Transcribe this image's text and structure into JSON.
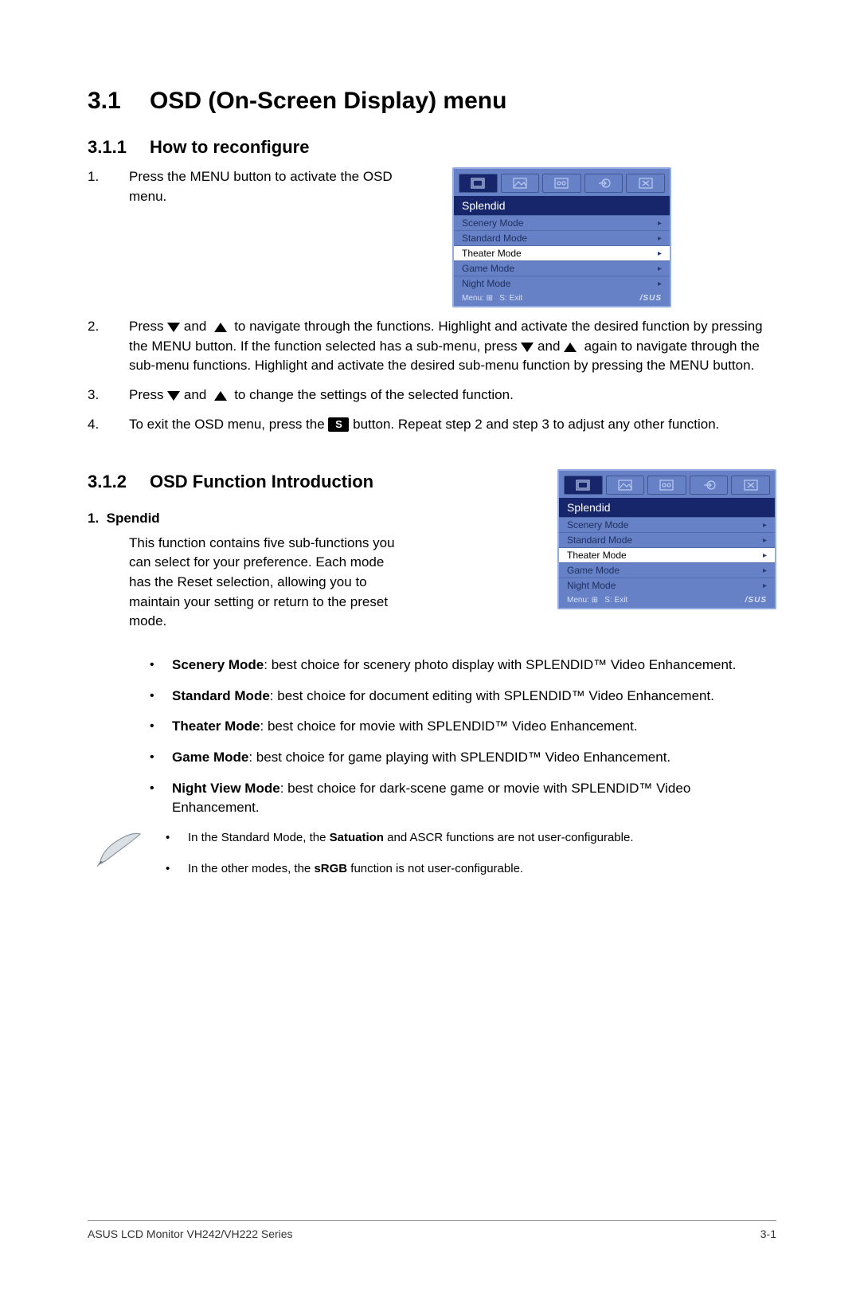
{
  "h1_num": "3.1",
  "h1_title": "OSD (On-Screen Display) menu",
  "h2a_num": "3.1.1",
  "h2a_title": "How to reconfigure",
  "step1": "Press the MENU button to activate the OSD menu.",
  "step2a": "Press ",
  "step2b": " and ",
  "step2c": " to navigate through the functions. Highlight and activate the desired function by pressing the MENU button. If the function selected has a sub-menu, press ",
  "step2d": " and ",
  "step2e": " again to navigate through the sub-menu functions. Highlight and activate the desired sub-menu function by pressing the MENU button.",
  "step3a": "Press ",
  "step3b": " and ",
  "step3c": " to change the settings of the selected function.",
  "step4a": "To exit the OSD menu, press the ",
  "step4b": " button. Repeat step 2 and step 3 to adjust any other function.",
  "s_label": "S",
  "h2b_num": "3.1.2",
  "h2b_title": "OSD Function Introduction",
  "sub1_num": "1.",
  "sub1_title": "Spendid",
  "sub1_body": "This function contains five sub-functions you can select for your preference. Each mode has the Reset selection, allowing you to maintain your setting or return to the preset mode.",
  "b1_t": "Scenery Mode",
  "b1_r": ": best choice for scenery photo display with SPLENDID™ Video Enhancement.",
  "b2_t": "Standard Mode",
  "b2_r": ": best choice for document editing with SPLENDID™ Video Enhancement.",
  "b3_t": "Theater Mode",
  "b3_r": ": best choice for movie with SPLENDID™ Video Enhancement.",
  "b4_t": "Game Mode",
  "b4_r": ": best choice for game playing with SPLENDID™ Video Enhancement.",
  "b5_t": "Night View Mode",
  "b5_r": ": best choice for dark-scene game or movie with SPLENDID™ Video Enhancement.",
  "n1a": "In the Standard Mode, the ",
  "n1b": "Satuation",
  "n1c": " and ASCR functions are not user-configurable.",
  "n2a": "In the other modes, the ",
  "n2b": "sRGB",
  "n2c": " function is not user-configurable.",
  "osd": {
    "title": "Splendid",
    "items": [
      "Scenery Mode",
      "Standard Mode",
      "Theater Mode",
      "Game Mode",
      "Night Mode"
    ],
    "selectedIndex": 2,
    "foot_menu": "Menu: ",
    "foot_exit": "S: Exit",
    "brand": "/SUS"
  },
  "footer_left": "ASUS LCD Monitor VH242/VH222 Series",
  "footer_right": "3-1"
}
